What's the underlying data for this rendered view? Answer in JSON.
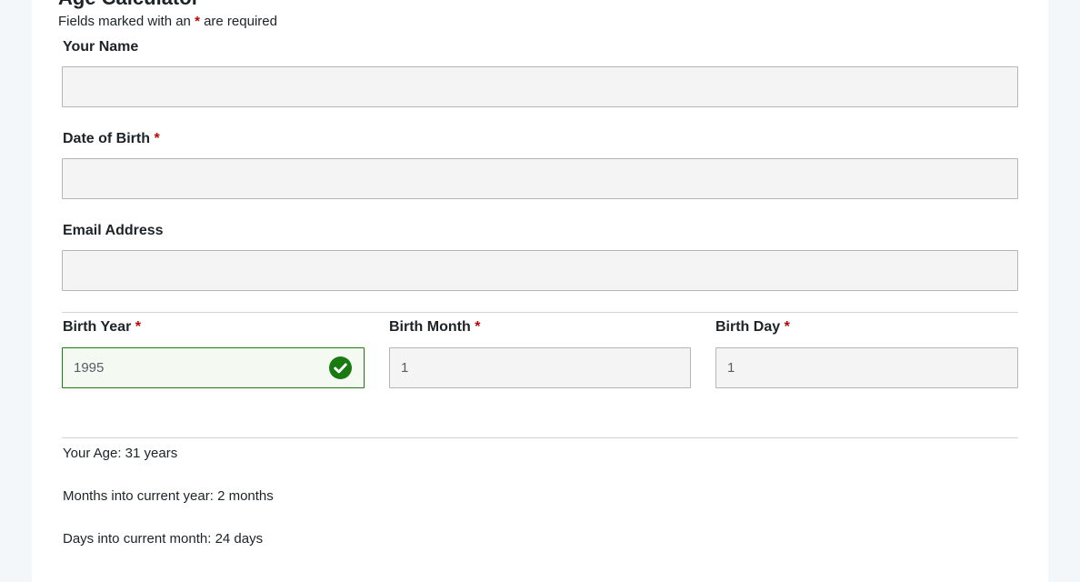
{
  "form": {
    "title": "Age Calculator",
    "required_note_prefix": "Fields marked with an ",
    "required_marker": "*",
    "required_note_suffix": " are required"
  },
  "fields": {
    "name": {
      "label": "Your Name",
      "value": ""
    },
    "dob": {
      "label": "Date of Birth",
      "value": ""
    },
    "email": {
      "label": "Email Address",
      "value": ""
    },
    "birth_year": {
      "label": "Birth Year",
      "value": "1995"
    },
    "birth_month": {
      "label": "Birth Month",
      "value": "1"
    },
    "birth_day": {
      "label": "Birth Day",
      "value": "1"
    }
  },
  "results": {
    "age": "Your Age: 31 years",
    "months": "Months into current year: 2 months",
    "days": "Days into current month: 24 days"
  },
  "colors": {
    "required": "#c00000",
    "valid_border": "#1a7a12",
    "valid_icon": "#1a7a12"
  }
}
